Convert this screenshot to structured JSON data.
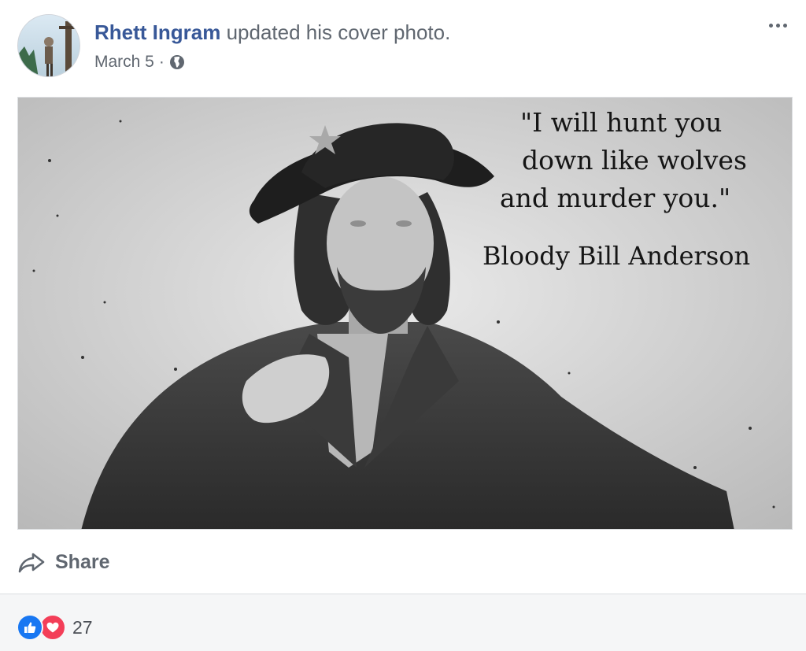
{
  "post": {
    "author_name": "Rhett Ingram",
    "action_text": " updated his cover photo.",
    "date": "March 5",
    "separator": "·",
    "privacy_icon": "globe-icon",
    "more_icon": "more-options-icon"
  },
  "photo": {
    "quote_line_1": "\"I will hunt you",
    "quote_line_2": "down like wolves",
    "quote_line_3": "and murder you.\"",
    "attribution": "Bloody Bill Anderson"
  },
  "actions": {
    "share_label": "Share",
    "share_icon": "share-arrow-icon"
  },
  "reactions": {
    "icons": [
      "like-icon",
      "love-icon"
    ],
    "count": "27",
    "like_color": "#1877f2",
    "love_color": "#f33e58"
  },
  "colors": {
    "author_link": "#385898",
    "secondary_text": "#606770"
  }
}
